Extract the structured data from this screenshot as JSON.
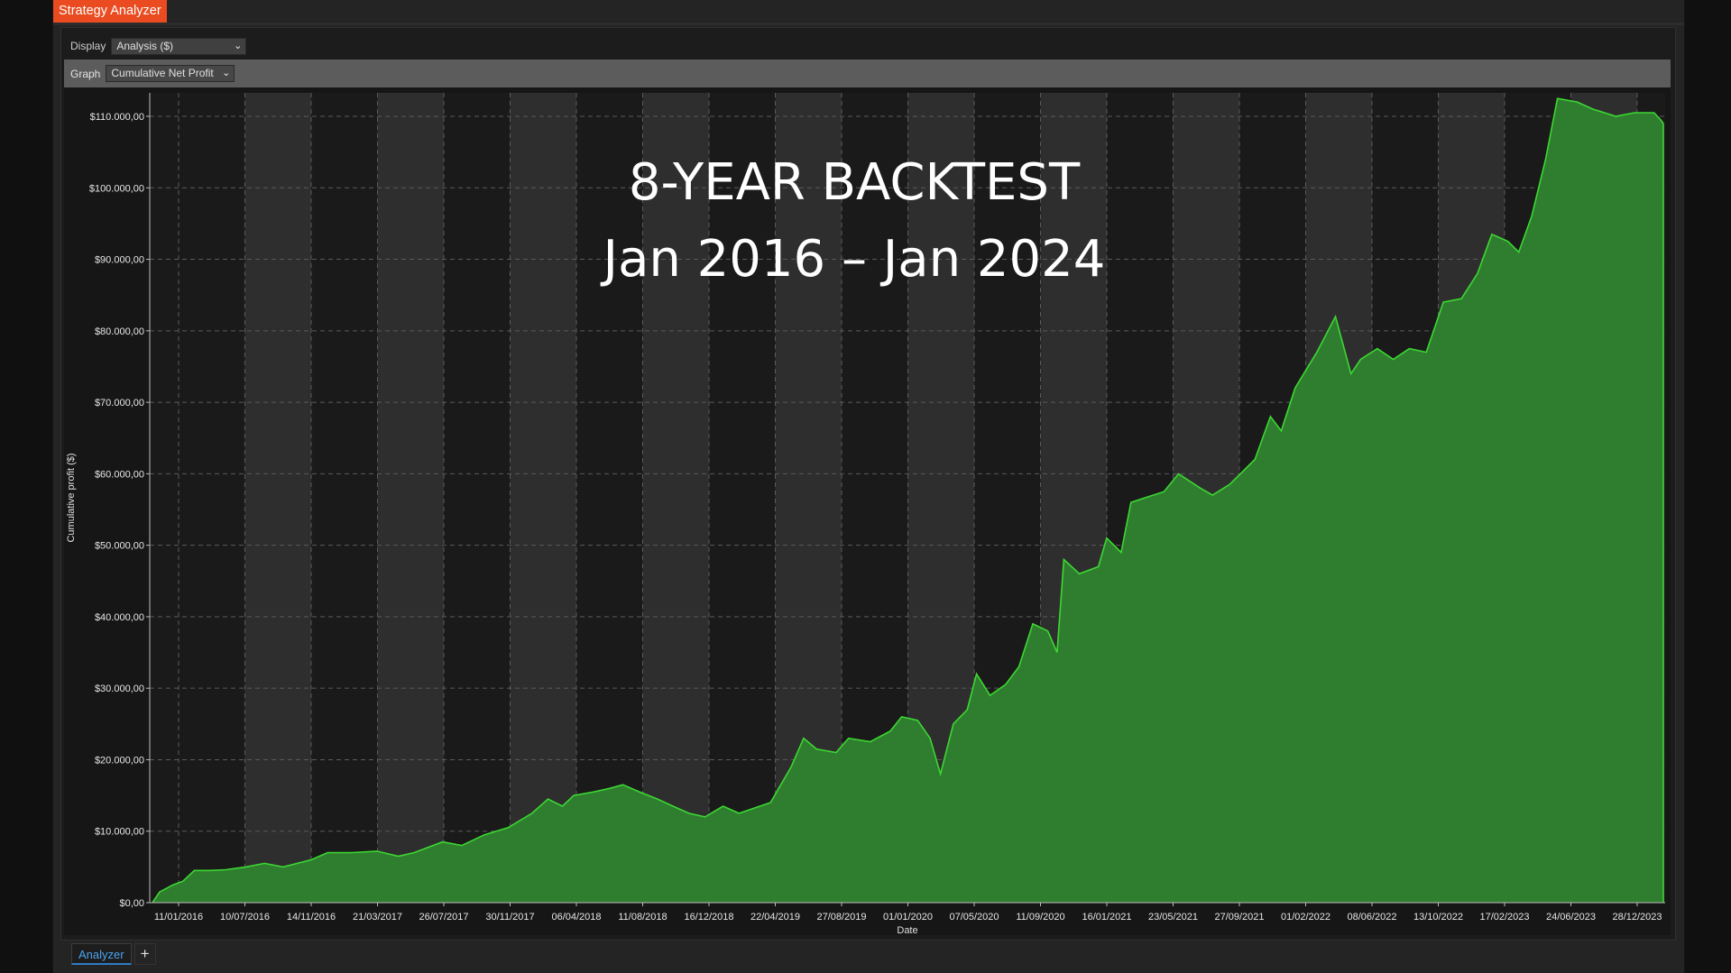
{
  "window": {
    "title": "Strategy Analyzer"
  },
  "toolbar": {
    "display_label": "Display",
    "display_value": "Analysis ($)",
    "graph_label": "Graph",
    "graph_value": "Cumulative Net Profit"
  },
  "overlay": {
    "line1": "8-YEAR BACKTEST",
    "line2": "Jan 2016 – Jan 2024"
  },
  "tabs": {
    "active": "Analyzer",
    "add_label": "+"
  },
  "colors": {
    "accent": "#ea4b20",
    "profit_line": "#3cd832",
    "profit_fill": "#2f7d2f",
    "tab_active": "#2d7ec6"
  },
  "chart_data": {
    "type": "area",
    "title": "",
    "xlabel": "Date",
    "ylabel": "Cumulative profit ($)",
    "ylim": [
      0,
      113000
    ],
    "grid": true,
    "yticks": [
      0,
      10000,
      20000,
      30000,
      40000,
      50000,
      60000,
      70000,
      80000,
      90000,
      100000,
      110000
    ],
    "ytick_labels": [
      "$0,00",
      "$10.000,00",
      "$20.000,00",
      "$30.000,00",
      "$40.000,00",
      "$50.000,00",
      "$60.000,00",
      "$70.000,00",
      "$80.000,00",
      "$90.000,00",
      "$100.000,00",
      "$110.000,00"
    ],
    "xtick_labels": [
      "11/01/2016",
      "10/07/2016",
      "14/11/2016",
      "21/03/2017",
      "26/07/2017",
      "30/11/2017",
      "06/04/2018",
      "11/08/2018",
      "16/12/2018",
      "22/04/2019",
      "27/08/2019",
      "01/01/2020",
      "07/05/2020",
      "11/09/2020",
      "16/01/2021",
      "23/05/2021",
      "27/09/2021",
      "01/02/2022",
      "08/06/2022",
      "13/10/2022",
      "17/02/2023",
      "24/06/2023",
      "28/12/2023"
    ],
    "x_range": [
      "2016-01-11",
      "2024-01-15"
    ],
    "series": [
      {
        "values": [
          [
            "2016-01-11",
            0
          ],
          [
            "2016-01-25",
            1500
          ],
          [
            "2016-02-20",
            2500
          ],
          [
            "2016-03-10",
            3000
          ],
          [
            "2016-04-01",
            4500
          ],
          [
            "2016-05-01",
            4500
          ],
          [
            "2016-06-01",
            4600
          ],
          [
            "2016-07-10",
            5000
          ],
          [
            "2016-08-15",
            5500
          ],
          [
            "2016-09-20",
            5000
          ],
          [
            "2016-11-14",
            6000
          ],
          [
            "2016-12-15",
            7000
          ],
          [
            "2017-02-01",
            7000
          ],
          [
            "2017-03-21",
            7200
          ],
          [
            "2017-05-01",
            6500
          ],
          [
            "2017-06-01",
            7000
          ],
          [
            "2017-07-26",
            8500
          ],
          [
            "2017-09-01",
            8000
          ],
          [
            "2017-10-15",
            9500
          ],
          [
            "2017-11-30",
            10500
          ],
          [
            "2018-01-15",
            12500
          ],
          [
            "2018-02-15",
            14500
          ],
          [
            "2018-03-15",
            13500
          ],
          [
            "2018-04-06",
            15000
          ],
          [
            "2018-05-15",
            15500
          ],
          [
            "2018-06-15",
            16000
          ],
          [
            "2018-07-10",
            16500
          ],
          [
            "2018-08-11",
            15500
          ],
          [
            "2018-09-15",
            14500
          ],
          [
            "2018-10-15",
            13500
          ],
          [
            "2018-11-15",
            12500
          ],
          [
            "2018-12-16",
            12000
          ],
          [
            "2019-01-20",
            13500
          ],
          [
            "2019-02-20",
            12500
          ],
          [
            "2019-04-22",
            14000
          ],
          [
            "2019-06-01",
            19000
          ],
          [
            "2019-06-25",
            23000
          ],
          [
            "2019-07-20",
            21500
          ],
          [
            "2019-08-27",
            21000
          ],
          [
            "2019-09-20",
            23000
          ],
          [
            "2019-11-01",
            22500
          ],
          [
            "2019-12-10",
            24000
          ],
          [
            "2020-01-01",
            26000
          ],
          [
            "2020-02-01",
            25500
          ],
          [
            "2020-02-25",
            23000
          ],
          [
            "2020-03-16",
            18000
          ],
          [
            "2020-04-10",
            25000
          ],
          [
            "2020-05-07",
            27000
          ],
          [
            "2020-05-25",
            32000
          ],
          [
            "2020-06-20",
            29000
          ],
          [
            "2020-07-20",
            30500
          ],
          [
            "2020-08-15",
            33000
          ],
          [
            "2020-09-11",
            39000
          ],
          [
            "2020-10-10",
            38000
          ],
          [
            "2020-10-28",
            35000
          ],
          [
            "2020-11-10",
            48000
          ],
          [
            "2020-12-10",
            46000
          ],
          [
            "2021-01-16",
            47000
          ],
          [
            "2021-02-01",
            51000
          ],
          [
            "2021-03-01",
            49000
          ],
          [
            "2021-03-20",
            56000
          ],
          [
            "2021-05-23",
            57500
          ],
          [
            "2021-06-20",
            60000
          ],
          [
            "2021-08-01",
            58000
          ],
          [
            "2021-08-25",
            57000
          ],
          [
            "2021-09-27",
            58500
          ],
          [
            "2021-11-15",
            62000
          ],
          [
            "2021-12-15",
            68000
          ],
          [
            "2022-01-05",
            66000
          ],
          [
            "2022-02-01",
            72000
          ],
          [
            "2022-03-15",
            77000
          ],
          [
            "2022-04-20",
            82000
          ],
          [
            "2022-05-20",
            74000
          ],
          [
            "2022-06-08",
            76000
          ],
          [
            "2022-07-10",
            77500
          ],
          [
            "2022-08-10",
            76000
          ],
          [
            "2022-09-10",
            77500
          ],
          [
            "2022-10-13",
            77000
          ],
          [
            "2022-11-15",
            84000
          ],
          [
            "2022-12-20",
            84500
          ],
          [
            "2023-01-20",
            88000
          ],
          [
            "2023-02-17",
            93500
          ],
          [
            "2023-03-20",
            92500
          ],
          [
            "2023-04-10",
            91000
          ],
          [
            "2023-05-05",
            96000
          ],
          [
            "2023-06-01",
            104000
          ],
          [
            "2023-06-24",
            112500
          ],
          [
            "2023-08-01",
            112000
          ],
          [
            "2023-09-01",
            111000
          ],
          [
            "2023-10-15",
            110000
          ],
          [
            "2023-11-20",
            110500
          ],
          [
            "2023-12-28",
            110500
          ],
          [
            "2024-01-10",
            109500
          ],
          [
            "2024-01-15",
            109000
          ]
        ]
      }
    ]
  }
}
